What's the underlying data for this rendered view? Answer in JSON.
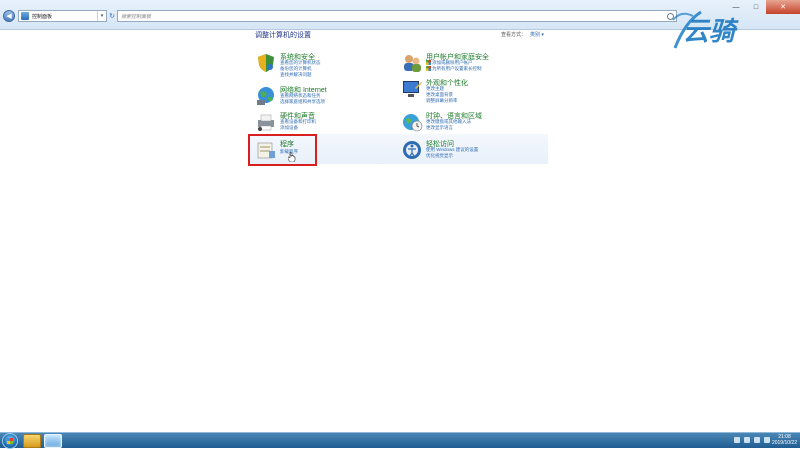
{
  "addressbar": {
    "path": "控制面板",
    "search_placeholder": "搜索控制面板"
  },
  "watermark": {
    "text": "云骑"
  },
  "heading": "调整计算机的设置",
  "viewby": {
    "label": "查看方式：",
    "value": "类别 ▾"
  },
  "categories": [
    {
      "title": "系统和安全",
      "links": [
        "查看您的计算机状态",
        "备份您的计算机",
        "查找并解决问题"
      ]
    },
    {
      "title": "用户帐户和家庭安全",
      "links": [
        "添加或删除用户帐户",
        "为所有用户设置家长控制"
      ]
    },
    {
      "title": "网络和 Internet",
      "links": [
        "查看网络状态和任务",
        "选择家庭组和共享选项"
      ]
    },
    {
      "title": "外观和个性化",
      "links": [
        "更改主题",
        "更改桌面背景",
        "调整屏幕分辨率"
      ]
    },
    {
      "title": "硬件和声音",
      "links": [
        "查看设备和打印机",
        "添加设备"
      ]
    },
    {
      "title": "时钟、语言和区域",
      "links": [
        "更改键盘或其他输入法",
        "更改显示语言"
      ]
    },
    {
      "title": "程序",
      "links": [
        "卸载程序"
      ]
    },
    {
      "title": "轻松访问",
      "links": [
        "使用 Windows 建议的设置",
        "优化视觉显示"
      ]
    }
  ],
  "clock": {
    "time": "21:08",
    "date": "2019/10/22"
  },
  "colors": {
    "category_title": "#1b7a29",
    "link": "#2e6ab1",
    "highlight": "#d81e1e"
  }
}
